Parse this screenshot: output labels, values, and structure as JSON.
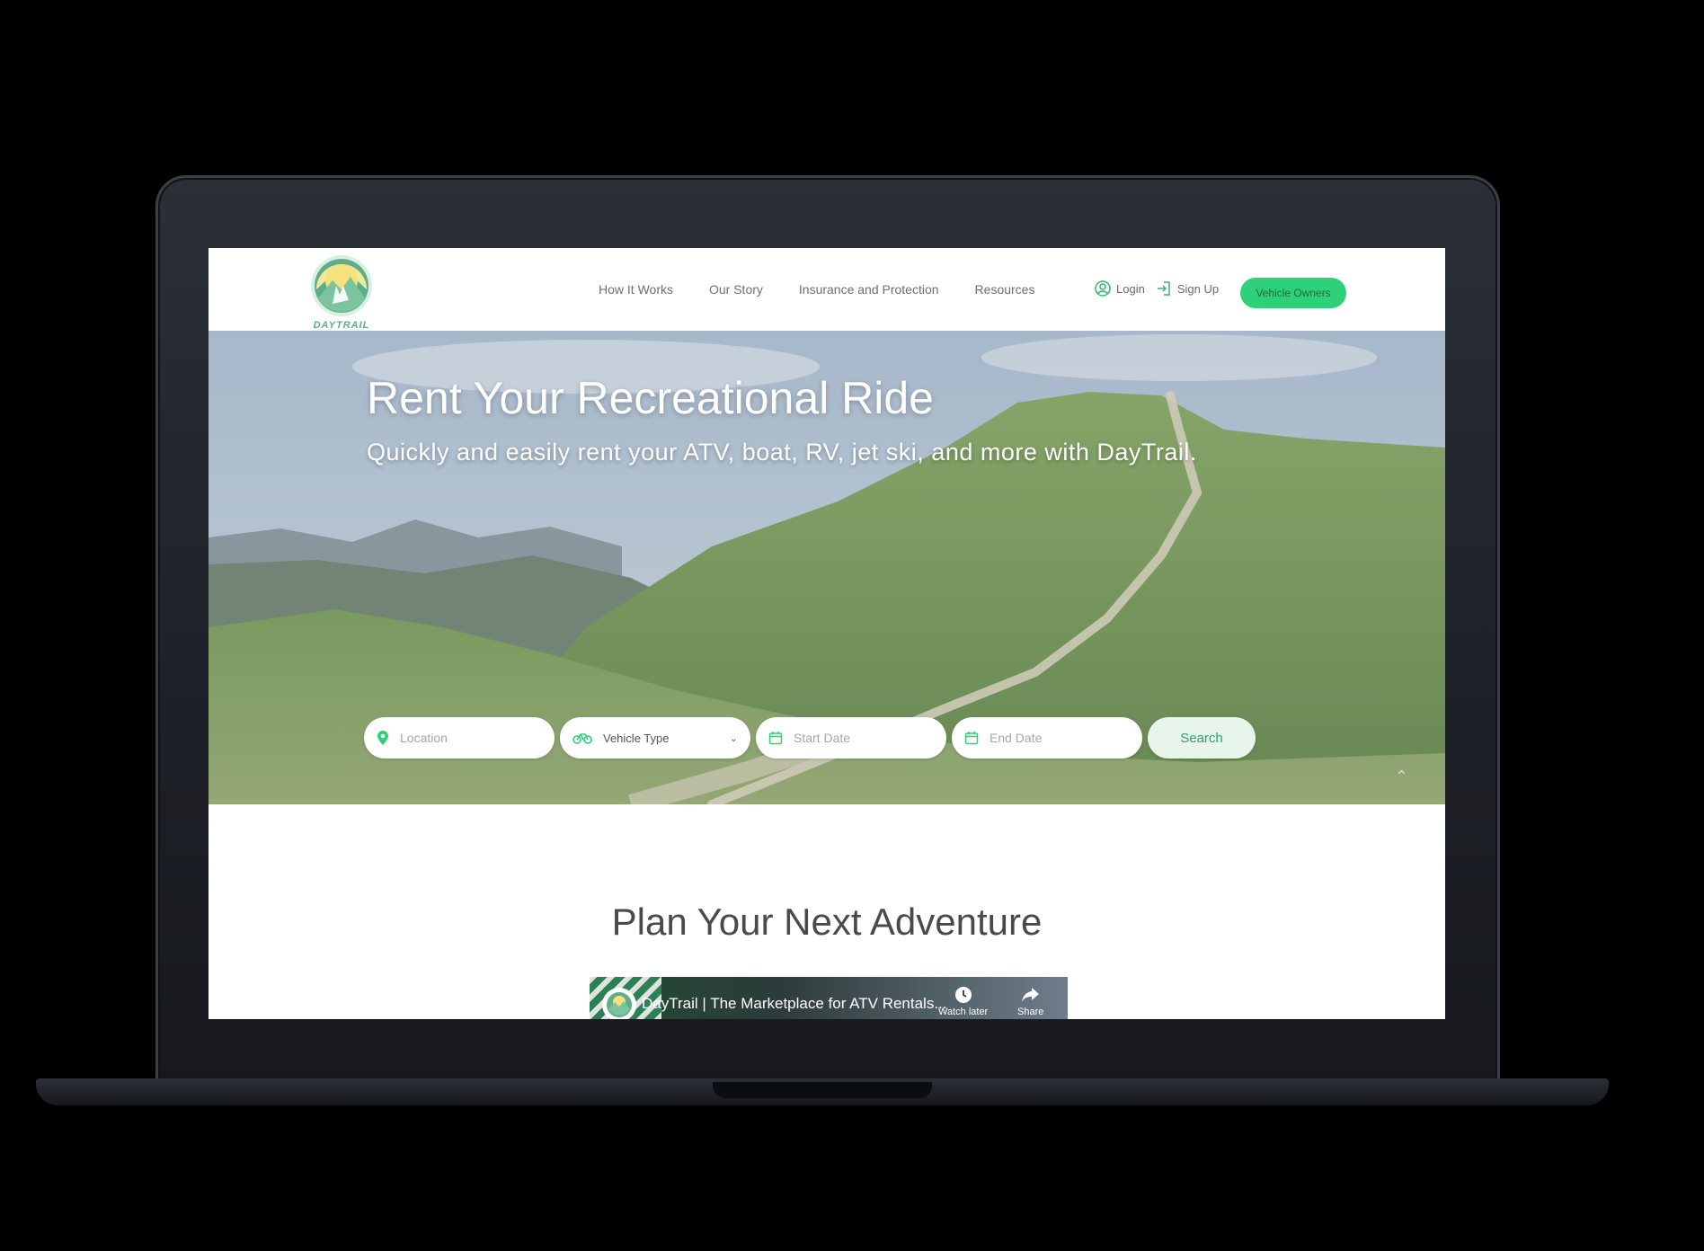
{
  "brand": {
    "name": "DAYTRAIL",
    "accent": "#2fd07a",
    "logo_green": "#5fae89"
  },
  "nav": {
    "links": [
      "How It Works",
      "Our Story",
      "Insurance and Protection",
      "Resources"
    ],
    "login": "Login",
    "signup": "Sign Up",
    "owners": "Vehicle Owners"
  },
  "hero": {
    "title": "Rent Your Recreational Ride",
    "subtitle": "Quickly and easily rent your ATV, boat, RV, jet ski, and more with DayTrail."
  },
  "search": {
    "location_placeholder": "Location",
    "vehicle_type": "Vehicle Type",
    "start_placeholder": "Start Date",
    "end_placeholder": "End Date",
    "button": "Search"
  },
  "section": {
    "title": "Plan Your Next Adventure"
  },
  "video": {
    "title": "DayTrail | The Marketplace for ATV Rentals...",
    "watch_later": "Watch later",
    "share": "Share"
  }
}
